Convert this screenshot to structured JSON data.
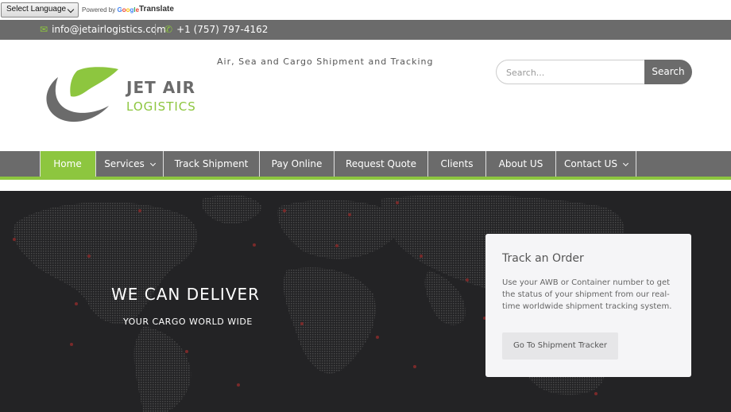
{
  "translate": {
    "select_label": "Select Language",
    "powered_by": "Powered by",
    "google": "Google",
    "translate": "Translate"
  },
  "contact": {
    "email": "info@jetairlogistics.com",
    "phone": "+1 (757) 797-4162",
    "email_icon": "envelope-icon",
    "phone_icon": "phone-icon"
  },
  "header": {
    "tagline": "Air, Sea and Cargo Shipment and Tracking",
    "logo_line1": "JET AIR",
    "logo_line2": "LOGISTICS",
    "search_placeholder": "Search...",
    "search_button": "Search"
  },
  "nav": {
    "items": [
      {
        "label": "Home",
        "active": true
      },
      {
        "label": "Services",
        "dropdown": true
      },
      {
        "label": "Track Shipment"
      },
      {
        "label": "Pay Online"
      },
      {
        "label": "Request Quote"
      },
      {
        "label": "Clients"
      },
      {
        "label": "About US"
      },
      {
        "label": "Contact US",
        "dropdown": true
      }
    ]
  },
  "hero": {
    "title": "WE CAN DELIVER",
    "subtitle": "YOUR CARGO WORLD WIDE"
  },
  "track_card": {
    "title": "Track an Order",
    "description": "Use your AWB or Container number to get the status of your shipment from our real-time worldwide shipment tracking system.",
    "button": "Go To Shipment Tracker"
  },
  "colors": {
    "accent": "#8dc63f",
    "bar": "#6b6b6b",
    "hero_bg": "#222222"
  }
}
